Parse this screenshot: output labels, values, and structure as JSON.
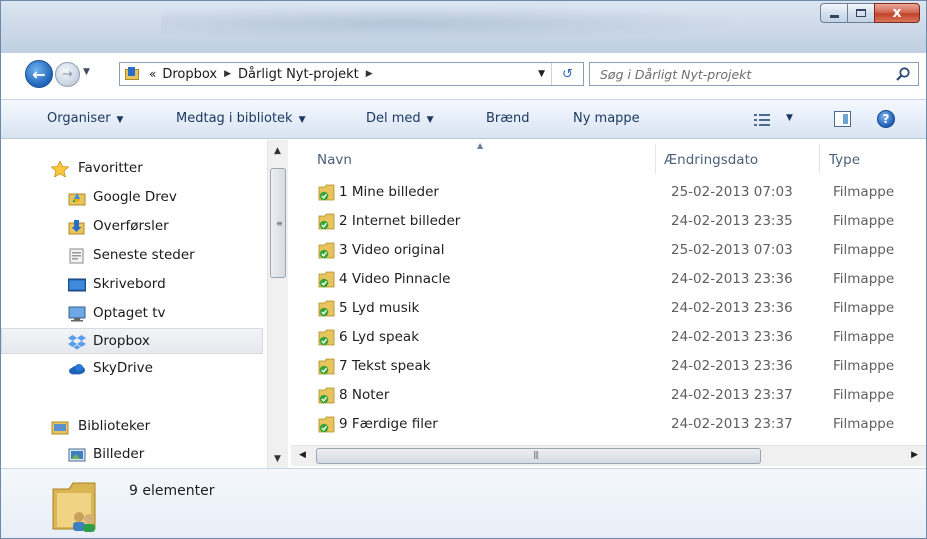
{
  "window": {
    "controls": {
      "minimize": "minimize-icon",
      "maximize": "maximize-icon",
      "close_glyph": "x"
    }
  },
  "address": {
    "overflow": "«",
    "crumbs": [
      "Dropbox",
      "Dårligt Nyt-projekt"
    ],
    "refresh_icon": "↺"
  },
  "search": {
    "placeholder": "Søg i Dårligt Nyt-projekt"
  },
  "toolbar": {
    "organize": "Organiser",
    "include_library": "Medtag i bibliotek",
    "share_with": "Del med",
    "burn": "Brænd",
    "new_folder": "Ny mappe"
  },
  "sidebar": {
    "favorites_header": "Favoritter",
    "favorites": [
      {
        "label": "Google Drev",
        "icon": "google-drive-icon"
      },
      {
        "label": "Overførsler",
        "icon": "downloads-icon"
      },
      {
        "label": "Seneste steder",
        "icon": "recent-places-icon"
      },
      {
        "label": "Skrivebord",
        "icon": "desktop-icon"
      },
      {
        "label": "Optaget tv",
        "icon": "recorded-tv-icon"
      },
      {
        "label": "Dropbox",
        "icon": "dropbox-icon",
        "selected": true
      },
      {
        "label": "SkyDrive",
        "icon": "skydrive-icon"
      }
    ],
    "libraries_header": "Biblioteker",
    "libraries": [
      {
        "label": "Billeder",
        "icon": "pictures-library-icon"
      }
    ]
  },
  "filelist": {
    "columns": {
      "name": "Navn",
      "date": "Ændringsdato",
      "type": "Type"
    },
    "rows": [
      {
        "name": "1 Mine billeder",
        "date": "25-02-2013 07:03",
        "type": "Filmappe"
      },
      {
        "name": "2 Internet billeder",
        "date": "24-02-2013 23:35",
        "type": "Filmappe"
      },
      {
        "name": "3 Video original",
        "date": "25-02-2013 07:03",
        "type": "Filmappe"
      },
      {
        "name": "4 Video Pinnacle",
        "date": "24-02-2013 23:36",
        "type": "Filmappe"
      },
      {
        "name": "5 Lyd musik",
        "date": "24-02-2013 23:36",
        "type": "Filmappe"
      },
      {
        "name": "6 Lyd speak",
        "date": "24-02-2013 23:36",
        "type": "Filmappe"
      },
      {
        "name": "7 Tekst speak",
        "date": "24-02-2013 23:36",
        "type": "Filmappe"
      },
      {
        "name": "8 Noter",
        "date": "24-02-2013 23:37",
        "type": "Filmappe"
      },
      {
        "name": "9 Færdige filer",
        "date": "24-02-2013 23:37",
        "type": "Filmappe"
      }
    ]
  },
  "details": {
    "count_text": "9 elementer"
  },
  "colors": {
    "accent": "#1e3961",
    "folder": "#e7c45e",
    "sync_check": "#3aa535",
    "selection": "#e6e9ee"
  }
}
